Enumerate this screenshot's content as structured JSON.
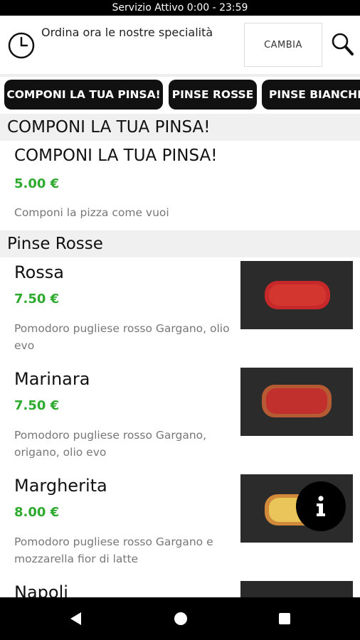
{
  "status": {
    "text": "Servizio Attivo  0:00 - 23:59"
  },
  "header": {
    "order_text": "Ordina ora le nostre specialità",
    "change_label": "CAMBIA"
  },
  "tabs": [
    {
      "label": "COMPONI LA TUA PINSA!"
    },
    {
      "label": "PINSE ROSSE"
    },
    {
      "label": "PINSE BIANCHE"
    }
  ],
  "sections": [
    {
      "title": "COMPONI LA TUA PINSA!",
      "items": [
        {
          "name": "COMPONI LA TUA PINSA!",
          "price": "5.00 €",
          "desc": "Componi la pizza come vuoi"
        }
      ]
    },
    {
      "title": "Pinse Rosse",
      "items": [
        {
          "name": "Rossa",
          "price": "7.50 €",
          "desc": "Pomodoro pugliese rosso Gargano, olio evo"
        },
        {
          "name": "Marinara",
          "price": "7.50 €",
          "desc": "Pomodoro pugliese rosso Gargano, origano, olio evo"
        },
        {
          "name": "Margherita",
          "price": "8.00 €",
          "desc": "Pomodoro pugliese rosso Gargano e mozzarella fior di latte"
        },
        {
          "name": "Napoli",
          "price": "",
          "desc": ""
        }
      ]
    }
  ],
  "colors": {
    "price": "#2eaa2e",
    "tab_bg": "#111111",
    "section_bg": "#f0f0f0"
  },
  "icons": [
    "clock-icon",
    "search-icon",
    "info-icon",
    "back-icon",
    "home-icon",
    "recents-icon"
  ]
}
